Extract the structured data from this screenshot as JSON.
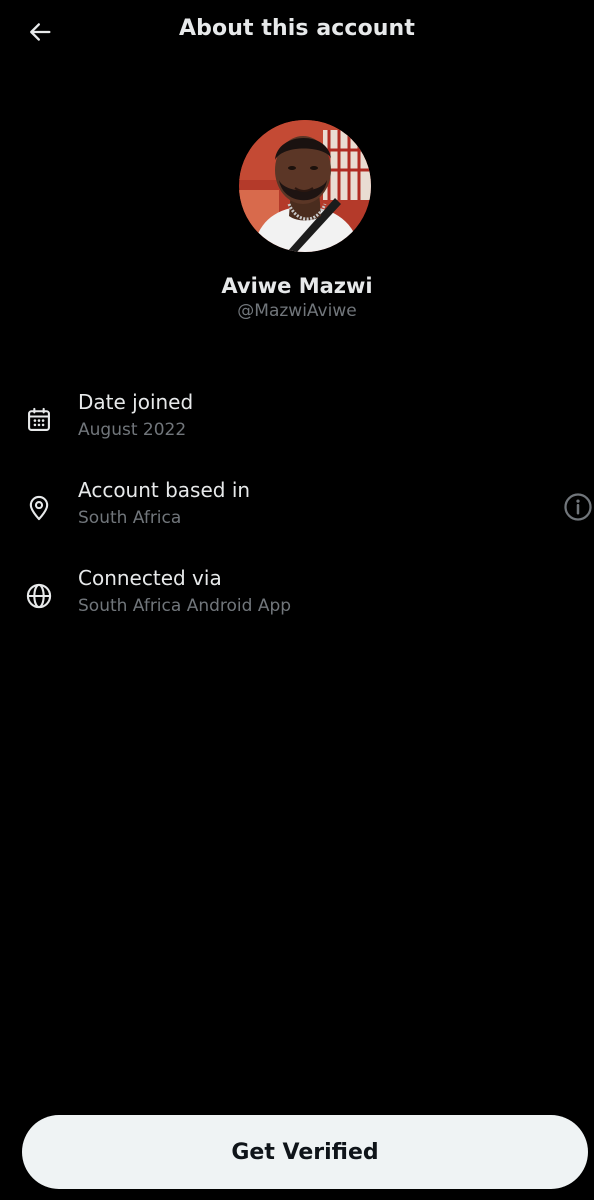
{
  "header": {
    "title": "About this account",
    "back_icon": "arrow-left-icon"
  },
  "profile": {
    "name": "Aviwe Mazwi",
    "handle": "@MazwiAviwe"
  },
  "details": [
    {
      "icon": "calendar-icon",
      "label": "Date joined",
      "value": "August 2022"
    },
    {
      "icon": "location-pin-icon",
      "label": "Account based in",
      "value": "South Africa"
    },
    {
      "icon": "globe-icon",
      "label": "Connected via",
      "value": "South Africa Android App"
    }
  ],
  "info_icon": "info-icon",
  "footer": {
    "verify_label": "Get Verified"
  },
  "colors": {
    "background": "#000000",
    "primary_text": "#e7e9ea",
    "secondary_text": "#71767b",
    "button_bg": "#eff3f4",
    "button_text": "#0f1419"
  }
}
